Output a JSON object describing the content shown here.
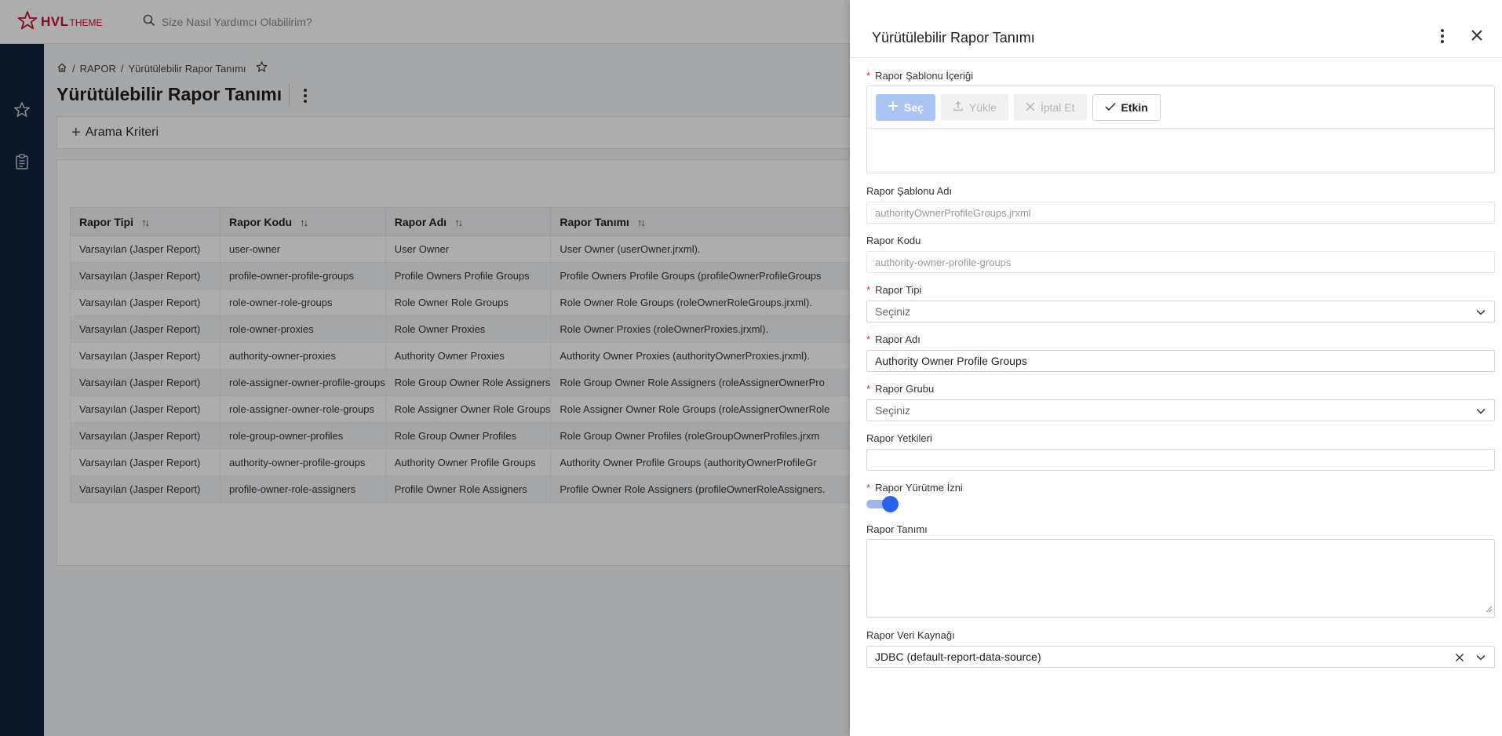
{
  "header": {
    "logo_text": "HVL",
    "logo_sub": "THEME",
    "search_placeholder": "Size Nasıl Yardımcı Olabilirim?"
  },
  "breadcrumb": {
    "items": [
      "RAPOR",
      "Yürütülebilir Rapor Tanımı"
    ]
  },
  "page": {
    "title": "Yürütülebilir Rapor Tanımı",
    "criteria_label": "Arama Kriteri"
  },
  "table": {
    "columns": [
      "Rapor Tipi",
      "Rapor Kodu",
      "Rapor Adı",
      "Rapor Tanımı"
    ],
    "rows": [
      [
        "Varsayılan (Jasper Report)",
        "user-owner",
        "User Owner",
        "User Owner (userOwner.jrxml)."
      ],
      [
        "Varsayılan (Jasper Report)",
        "profile-owner-profile-groups",
        "Profile Owners Profile Groups",
        "Profile Owners Profile Groups (profileOwnerProfileGroups"
      ],
      [
        "Varsayılan (Jasper Report)",
        "role-owner-role-groups",
        "Role Owner Role Groups",
        "Role Owner Role Groups (roleOwnerRoleGroups.jrxml)."
      ],
      [
        "Varsayılan (Jasper Report)",
        "role-owner-proxies",
        "Role Owner Proxies",
        "Role Owner Proxies (roleOwnerProxies.jrxml)."
      ],
      [
        "Varsayılan (Jasper Report)",
        "authority-owner-proxies",
        "Authority Owner Proxies",
        "Authority Owner Proxies (authorityOwnerProxies.jrxml)."
      ],
      [
        "Varsayılan (Jasper Report)",
        "role-assigner-owner-profile-groups",
        "Role Group Owner Role Assigners",
        "Role Group Owner Role Assigners (roleAssignerOwnerPro"
      ],
      [
        "Varsayılan (Jasper Report)",
        "role-assigner-owner-role-groups",
        "Role Assigner Owner Role Groups",
        "Role Assigner Owner Role Groups (roleAssignerOwnerRole"
      ],
      [
        "Varsayılan (Jasper Report)",
        "role-group-owner-profiles",
        "Role Group Owner Profiles",
        "Role Group Owner Profiles (roleGroupOwnerProfiles.jrxm"
      ],
      [
        "Varsayılan (Jasper Report)",
        "authority-owner-profile-groups",
        "Authority Owner Profile Groups",
        "Authority Owner Profile Groups (authorityOwnerProfileGr"
      ],
      [
        "Varsayılan (Jasper Report)",
        "profile-owner-role-assigners",
        "Profile Owner Role Assigners",
        "Profile Owner Role Assigners (profileOwnerRoleAssigners."
      ]
    ]
  },
  "drawer": {
    "title": "Yürütülebilir Rapor Tanımı",
    "template_content_label": "Rapor Şablonu İçeriği",
    "upload_buttons": {
      "select": "Seç",
      "upload": "Yükle",
      "cancel": "İptal Et",
      "active": "Etkin"
    },
    "template_name_label": "Rapor Şablonu Adı",
    "template_name_value": "authorityOwnerProfileGroups.jrxml",
    "code_label": "Rapor Kodu",
    "code_value": "authority-owner-profile-groups",
    "type_label": "Rapor Tipi",
    "type_value": "Seçiniz",
    "name_label": "Rapor Adı",
    "name_value": "Authority Owner Profile Groups",
    "group_label": "Rapor Grubu",
    "group_value": "Seçiniz",
    "permissions_label": "Rapor Yetkileri",
    "permissions_value": "",
    "exec_permission_label": "Rapor Yürütme İzni",
    "exec_permission_on": true,
    "description_label": "Rapor Tanımı",
    "description_value": "",
    "datasource_label": "Rapor Veri Kaynağı",
    "datasource_value": "JDBC (default-report-data-source)"
  },
  "colors": {
    "brand": "#c8102e",
    "sidebar": "#16233a",
    "primary": "#2a62e8",
    "required": "#d32f2f"
  }
}
